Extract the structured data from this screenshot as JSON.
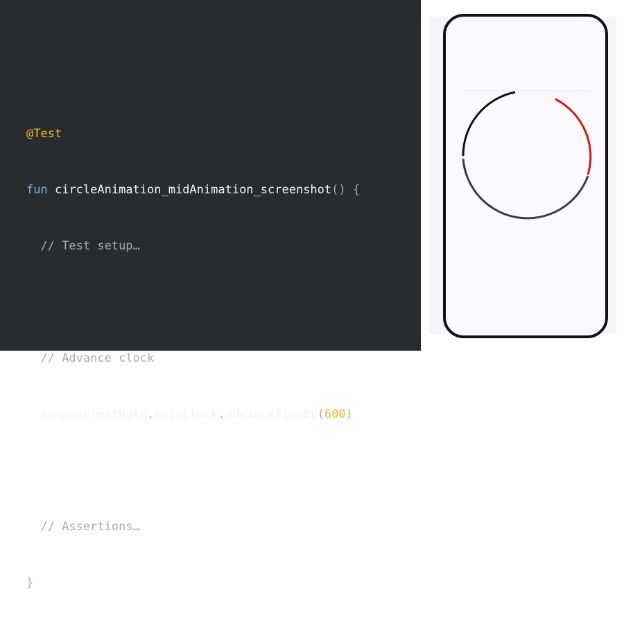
{
  "code": {
    "annotation": "@Test",
    "fun_keyword": "fun",
    "function_name": "circleAnimation_midAnimation_screenshot",
    "signature_suffix": "() {",
    "comment_setup": "// Test setup…",
    "comment_advance": "// Advance clock",
    "call_receiver": "composeTestRule",
    "dot1": ".",
    "call_property": "mainClock",
    "dot2": ".",
    "call_method": "advanceTimeBy",
    "paren_open": "(",
    "call_arg": "600",
    "paren_close": ")",
    "comment_assertions": "// Assertions…",
    "closing_brace": "}"
  },
  "preview": {
    "arc_colors": {
      "black_arc": "#111111",
      "red_arc": "#cc1f14",
      "dark_gray_arc": "#3d3a40"
    }
  },
  "colors": {
    "code_background": "#282c2e",
    "annotation": "#f2b531",
    "keyword": "#86a8e7",
    "comment": "#a8abad",
    "number": "#f2b531"
  }
}
